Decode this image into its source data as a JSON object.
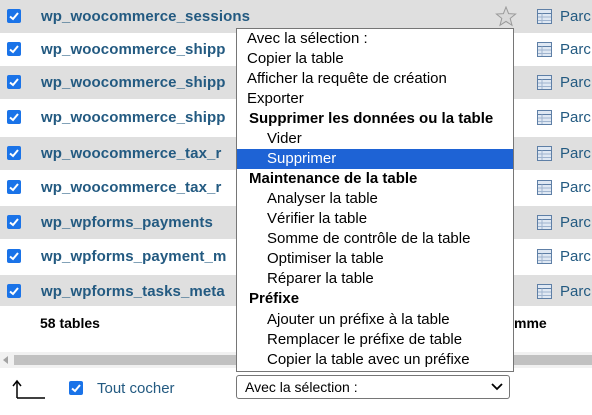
{
  "table_rows": [
    {
      "name": "wp_woocommerce_sessions",
      "action": "Parc"
    },
    {
      "name": "wp_woocommerce_shipp",
      "action": "Parc"
    },
    {
      "name": "wp_woocommerce_shipp",
      "action": "Parc"
    },
    {
      "name": "wp_woocommerce_shipp",
      "action": "Parc"
    },
    {
      "name": "wp_woocommerce_tax_r",
      "action": "Parc"
    },
    {
      "name": "wp_woocommerce_tax_r",
      "action": "Parc"
    },
    {
      "name": "wp_wpforms_payments",
      "action": "Parc"
    },
    {
      "name": "wp_wpforms_payment_m",
      "action": "Parc"
    },
    {
      "name": "wp_wpforms_tasks_meta",
      "action": "Parc"
    }
  ],
  "summary": {
    "count": "58 tables",
    "sum_label": "mme"
  },
  "footer": {
    "check_all_label": "Tout cocher",
    "select_value": "Avec la sélection :"
  },
  "dropdown": {
    "options": [
      {
        "label": "Avec la sélection :",
        "kind": "lvl0"
      },
      {
        "label": "Copier la table",
        "kind": "lvl0"
      },
      {
        "label": "Afficher la requête de création",
        "kind": "lvl0"
      },
      {
        "label": "Exporter",
        "kind": "lvl0"
      },
      {
        "label": "Supprimer les données ou la table",
        "kind": "group"
      },
      {
        "label": "Vider",
        "kind": "lvl1"
      },
      {
        "label": "Supprimer",
        "kind": "lvl1",
        "selected": true
      },
      {
        "label": "Maintenance de la table",
        "kind": "group"
      },
      {
        "label": "Analyser la table",
        "kind": "lvl1"
      },
      {
        "label": "Vérifier la table",
        "kind": "lvl1"
      },
      {
        "label": "Somme de contrôle de la table",
        "kind": "lvl1"
      },
      {
        "label": "Optimiser la table",
        "kind": "lvl1"
      },
      {
        "label": "Réparer la table",
        "kind": "lvl1"
      },
      {
        "label": "Préfixe",
        "kind": "group"
      },
      {
        "label": "Ajouter un préfixe à la table",
        "kind": "lvl1"
      },
      {
        "label": "Remplacer le préfixe de table",
        "kind": "lvl1"
      },
      {
        "label": "Copier la table avec un préfixe",
        "kind": "lvl1"
      }
    ]
  },
  "colors": {
    "link": "#235a81",
    "checkbox": "#1a73e8",
    "selection": "#1e63d5",
    "row_alt": "#dfdfdf"
  },
  "icons": {
    "favorite": "star-icon",
    "browse": "browse-table-icon",
    "check_all_arrow": "arrow-up-left-icon"
  }
}
